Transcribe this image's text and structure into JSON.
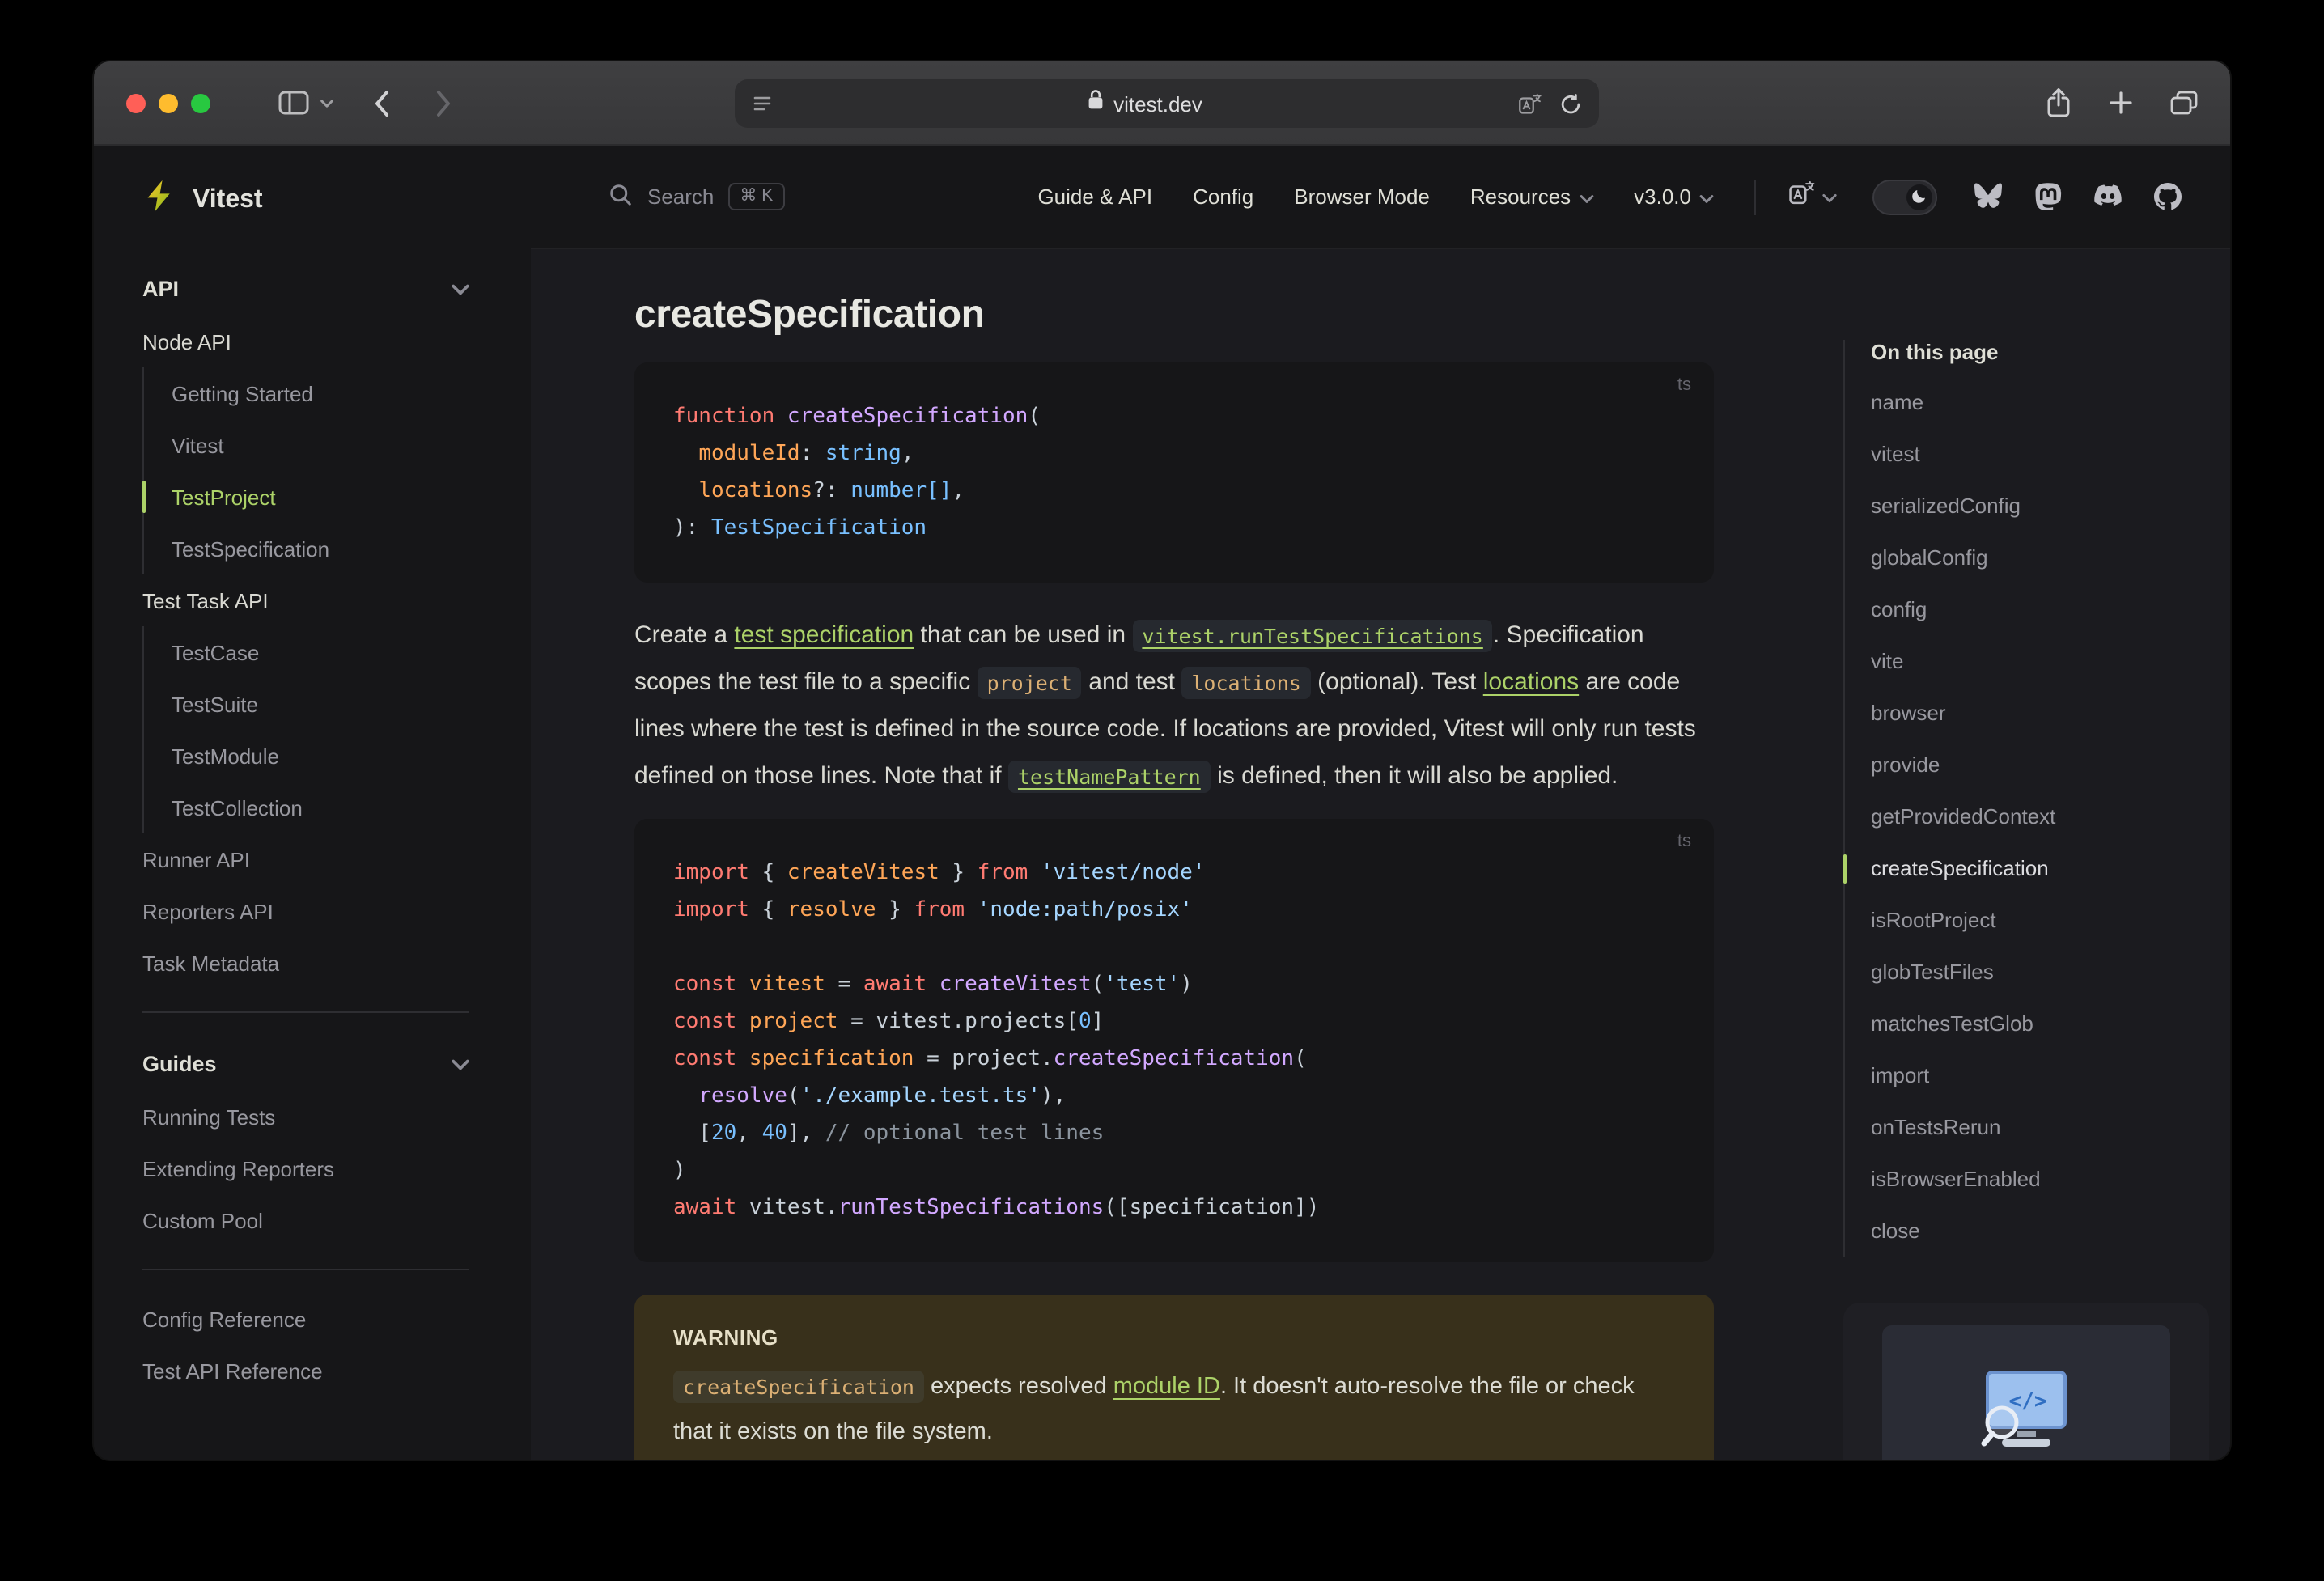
{
  "colors": {
    "accent": "#acd268",
    "sidebar_bg": "#161618",
    "content_bg": "#1b1b1f",
    "code_keyword": "#ff7b72",
    "code_function": "#d2a8ff",
    "code_variable": "#ffa657",
    "code_constant": "#79c0ff",
    "code_string": "#a5d6ff",
    "code_comment": "#8b949e",
    "inline_code": "#dcb074",
    "warning_bg": "rgba(234,179,8,0.14)"
  },
  "browser_chrome": {
    "domain": "vitest.dev",
    "traffic_lights": [
      "#ff5f57",
      "#febc2e",
      "#28c840"
    ],
    "buttons": [
      "sidebar-toggle",
      "tab-group-chevron",
      "back",
      "forward",
      "page-settings",
      "translate",
      "reload",
      "share",
      "new-tab",
      "tab-overview"
    ]
  },
  "sidebar": {
    "brand": "Vitest",
    "items": [
      {
        "label": "API",
        "type": "section",
        "chevron": true
      },
      {
        "label": "Node API",
        "type": "heading"
      },
      {
        "label": "Getting Started",
        "type": "sub"
      },
      {
        "label": "Vitest",
        "type": "sub"
      },
      {
        "label": "TestProject",
        "type": "sub",
        "active": true
      },
      {
        "label": "TestSpecification",
        "type": "sub"
      },
      {
        "label": "Test Task API",
        "type": "heading"
      },
      {
        "label": "TestCase",
        "type": "sub"
      },
      {
        "label": "TestSuite",
        "type": "sub"
      },
      {
        "label": "TestModule",
        "type": "sub"
      },
      {
        "label": "TestCollection",
        "type": "sub"
      },
      {
        "label": "Runner API",
        "type": "item"
      },
      {
        "label": "Reporters API",
        "type": "item"
      },
      {
        "label": "Task Metadata",
        "type": "item"
      },
      {
        "type": "divider"
      },
      {
        "label": "Guides",
        "type": "section",
        "chevron": true
      },
      {
        "label": "Running Tests",
        "type": "item"
      },
      {
        "label": "Extending Reporters",
        "type": "item"
      },
      {
        "label": "Custom Pool",
        "type": "item"
      },
      {
        "type": "divider"
      },
      {
        "label": "Config Reference",
        "type": "item"
      },
      {
        "label": "Test API Reference",
        "type": "item"
      }
    ]
  },
  "navbar": {
    "search": {
      "label": "Search",
      "kbd": "⌘ K"
    },
    "links": [
      {
        "label": "Guide & API"
      },
      {
        "label": "Config"
      },
      {
        "label": "Browser Mode"
      },
      {
        "label": "Resources",
        "chevron": true
      },
      {
        "label": "v3.0.0",
        "chevron": true
      }
    ],
    "icons": [
      "search",
      "translate",
      "theme-toggle-moon",
      "bluesky",
      "mastodon",
      "discord",
      "github"
    ],
    "social": [
      "bluesky",
      "mastodon",
      "discord",
      "github"
    ],
    "theme_toggle_state": "dark"
  },
  "content": {
    "title": "createSpecification",
    "code_blocks": [
      {
        "lang": "ts",
        "lines": [
          [
            {
              "c": "k",
              "t": "function "
            },
            {
              "c": "fn",
              "t": "createSpecification"
            },
            {
              "c": "pl",
              "t": "("
            }
          ],
          [
            {
              "c": "pl",
              "t": "  "
            },
            {
              "c": "v",
              "t": "moduleId"
            },
            {
              "c": "pl",
              "t": ": "
            },
            {
              "c": "ty",
              "t": "string"
            },
            {
              "c": "pl",
              "t": ","
            }
          ],
          [
            {
              "c": "pl",
              "t": "  "
            },
            {
              "c": "v",
              "t": "locations"
            },
            {
              "c": "pl",
              "t": "?: "
            },
            {
              "c": "ty",
              "t": "number[]"
            },
            {
              "c": "pl",
              "t": ","
            }
          ],
          [
            {
              "c": "pl",
              "t": "): "
            },
            {
              "c": "ty",
              "t": "TestSpecification"
            }
          ]
        ]
      },
      {
        "lang": "ts",
        "lines": [
          [
            {
              "c": "k",
              "t": "import"
            },
            {
              "c": "pl",
              "t": " { "
            },
            {
              "c": "v",
              "t": "createVitest"
            },
            {
              "c": "pl",
              "t": " } "
            },
            {
              "c": "k",
              "t": "from"
            },
            {
              "c": "str",
              "t": " 'vitest/node'"
            }
          ],
          [
            {
              "c": "k",
              "t": "import"
            },
            {
              "c": "pl",
              "t": " { "
            },
            {
              "c": "v",
              "t": "resolve"
            },
            {
              "c": "pl",
              "t": " } "
            },
            {
              "c": "k",
              "t": "from"
            },
            {
              "c": "str",
              "t": " 'node:path/posix'"
            }
          ],
          [],
          [
            {
              "c": "k",
              "t": "const"
            },
            {
              "c": "v",
              "t": " vitest"
            },
            {
              "c": "pl",
              "t": " = "
            },
            {
              "c": "k",
              "t": "await"
            },
            {
              "c": "fn",
              "t": " createVitest"
            },
            {
              "c": "pl",
              "t": "("
            },
            {
              "c": "str",
              "t": "'test'"
            },
            {
              "c": "pl",
              "t": ")"
            }
          ],
          [
            {
              "c": "k",
              "t": "const"
            },
            {
              "c": "v",
              "t": " project"
            },
            {
              "c": "pl",
              "t": " = vitest.projects["
            },
            {
              "c": "ty",
              "t": "0"
            },
            {
              "c": "pl",
              "t": "]"
            }
          ],
          [
            {
              "c": "k",
              "t": "const"
            },
            {
              "c": "v",
              "t": " specification"
            },
            {
              "c": "pl",
              "t": " = project."
            },
            {
              "c": "fn",
              "t": "createSpecification"
            },
            {
              "c": "pl",
              "t": "("
            }
          ],
          [
            {
              "c": "pl",
              "t": "  "
            },
            {
              "c": "fn",
              "t": "resolve"
            },
            {
              "c": "pl",
              "t": "("
            },
            {
              "c": "str",
              "t": "'./example.test.ts'"
            },
            {
              "c": "pl",
              "t": "),"
            }
          ],
          [
            {
              "c": "pl",
              "t": "  ["
            },
            {
              "c": "ty",
              "t": "20"
            },
            {
              "c": "pl",
              "t": ", "
            },
            {
              "c": "ty",
              "t": "40"
            },
            {
              "c": "pl",
              "t": "], "
            },
            {
              "c": "cm",
              "t": "// optional test lines"
            }
          ],
          [
            {
              "c": "pl",
              "t": ")"
            }
          ],
          [
            {
              "c": "k",
              "t": "await"
            },
            {
              "c": "pl",
              "t": " vitest."
            },
            {
              "c": "fn",
              "t": "runTestSpecifications"
            },
            {
              "c": "pl",
              "t": "([specification])"
            }
          ]
        ]
      }
    ],
    "paragraph": [
      {
        "s": "text",
        "t": "Create a "
      },
      {
        "s": "link",
        "t": "test specification"
      },
      {
        "s": "text",
        "t": " that can be used in "
      },
      {
        "s": "codelink",
        "t": "vitest.runTestSpecifications"
      },
      {
        "s": "text",
        "t": ". Specification scopes the test file to a specific "
      },
      {
        "s": "code",
        "t": "project"
      },
      {
        "s": "text",
        "t": " and test "
      },
      {
        "s": "code",
        "t": "locations"
      },
      {
        "s": "text",
        "t": " (optional). Test "
      },
      {
        "s": "link",
        "t": "locations"
      },
      {
        "s": "text",
        "t": " are code lines where the test is defined in the source code. If locations are provided, Vitest will only run tests defined on those lines. Note that if "
      },
      {
        "s": "codelink",
        "t": "testNamePattern"
      },
      {
        "s": "text",
        "t": " is defined, then it will also be applied."
      }
    ],
    "warning": {
      "title": "WARNING",
      "runs": [
        {
          "s": "code",
          "t": "createSpecification"
        },
        {
          "s": "text",
          "t": " expects resolved "
        },
        {
          "s": "link",
          "t": "module ID"
        },
        {
          "s": "text",
          "t": ". It doesn't auto-resolve the file or check that it exists on the file system."
        }
      ]
    }
  },
  "outline": {
    "title": "On this page",
    "items": [
      "name",
      "vitest",
      "serializedConfig",
      "globalConfig",
      "config",
      "vite",
      "browser",
      "provide",
      "getProvidedContext",
      "createSpecification",
      "isRootProject",
      "globTestFiles",
      "matchesTestGlob",
      "import",
      "onTestsRerun",
      "isBrowserEnabled",
      "close"
    ],
    "active": "createSpecification"
  }
}
